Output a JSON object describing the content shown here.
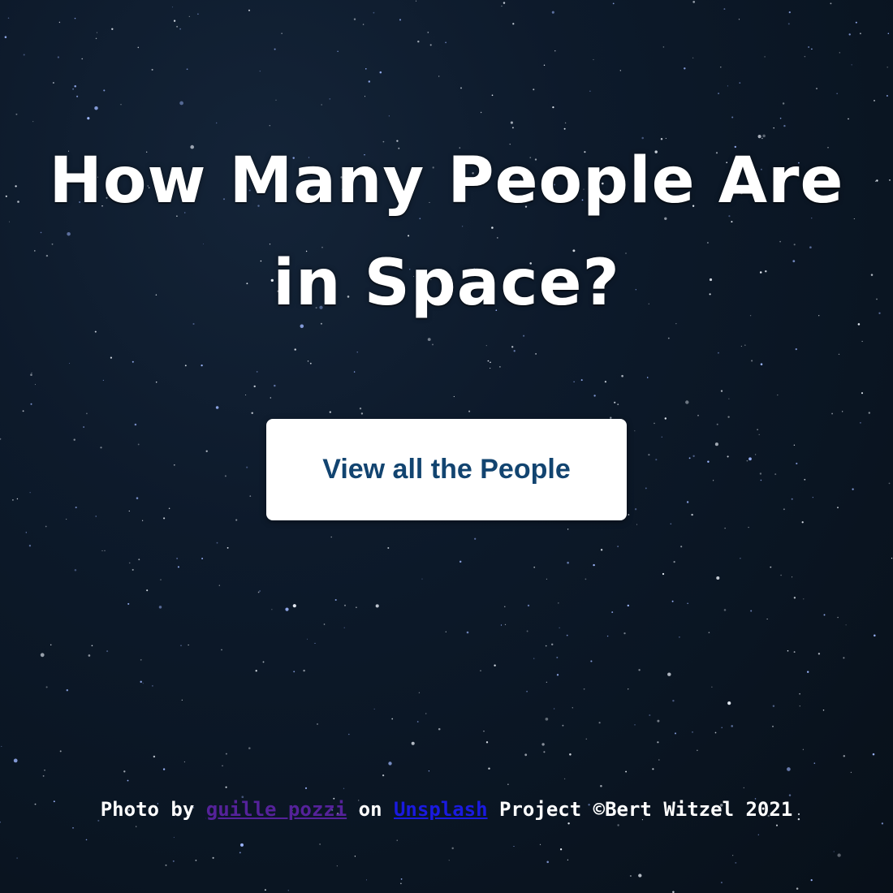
{
  "page": {
    "title_line1": "How Many People Are",
    "title_line2": "in Space?"
  },
  "cta": {
    "label": "View all the People"
  },
  "footer": {
    "prefix": "Photo by",
    "author_link": "guille pozzi",
    "middle": "on",
    "site_link": "Unsplash",
    "suffix": "Project ©Bert Witzel 2021"
  },
  "colors": {
    "background": "#0d1a2b",
    "title": "#ffffff",
    "button_bg": "#ffffff",
    "button_text": "#124470",
    "link_visited": "#55229a",
    "link_default": "#1a1ae0"
  }
}
